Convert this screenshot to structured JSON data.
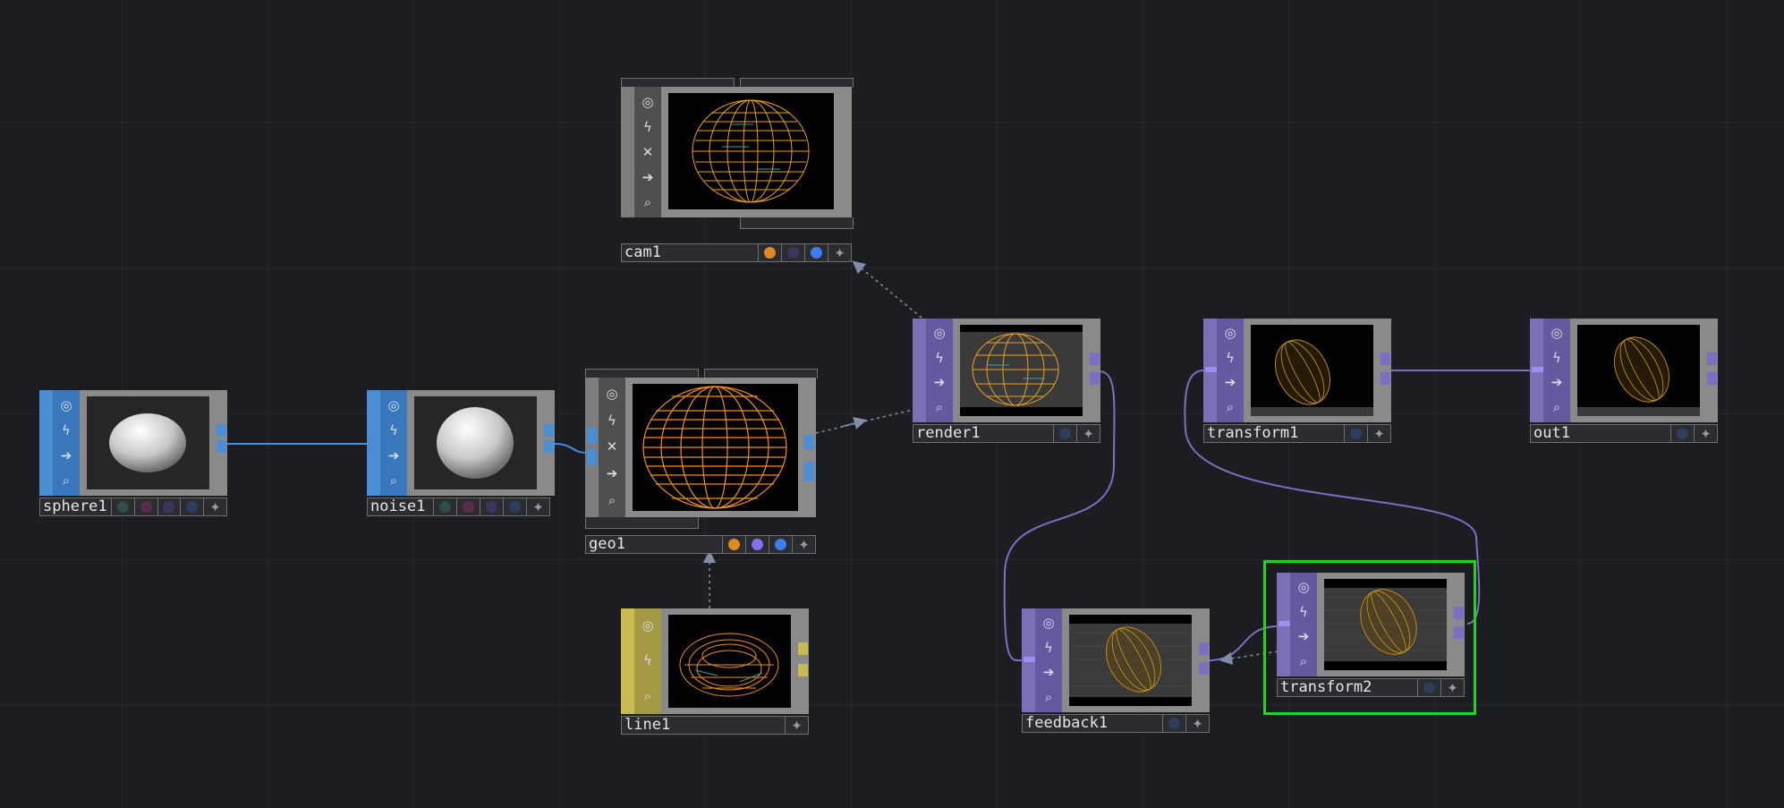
{
  "app": "TouchDesigner network editor",
  "colors": {
    "background": "#1c1d21",
    "sop_accent": "#4a8fd6",
    "top_accent": "#7b6fb8",
    "comp_accent": "#c9bb52",
    "wire_sop": "#3d8fe0",
    "wire_top": "#7a6fc2",
    "wire_ref": "#8090a8",
    "selection": "#22d422",
    "flag_orange": "#e08a1e",
    "flag_purple": "#8a6cf0",
    "flag_blue": "#3a7ef0"
  },
  "nodes": [
    {
      "id": "cam1",
      "label": "cam1",
      "family": "COMP",
      "preview": "wire-sphere-orange"
    },
    {
      "id": "sphere1",
      "label": "sphere1",
      "family": "SOP",
      "preview": "shaded-sphere"
    },
    {
      "id": "noise1",
      "label": "noise1",
      "family": "SOP",
      "preview": "shaded-sphere"
    },
    {
      "id": "geo1",
      "label": "geo1",
      "family": "COMP",
      "preview": "wire-sphere-orange"
    },
    {
      "id": "line1",
      "label": "line1",
      "family": "COMP",
      "preview": "wire-torus"
    },
    {
      "id": "render1",
      "label": "render1",
      "family": "TOP",
      "preview": "render-sphere"
    },
    {
      "id": "transform1",
      "label": "transform1",
      "family": "TOP",
      "preview": "yellow-egg"
    },
    {
      "id": "out1",
      "label": "out1",
      "family": "TOP",
      "preview": "yellow-egg"
    },
    {
      "id": "feedback1",
      "label": "feedback1",
      "family": "TOP",
      "preview": "checker-egg"
    },
    {
      "id": "transform2",
      "label": "transform2",
      "family": "TOP",
      "preview": "checker-egg",
      "selected": true
    }
  ],
  "icons": [
    "viewer-icon",
    "bypass-icon",
    "cook-icon",
    "display-icon",
    "lock-icon",
    "add-icon"
  ]
}
